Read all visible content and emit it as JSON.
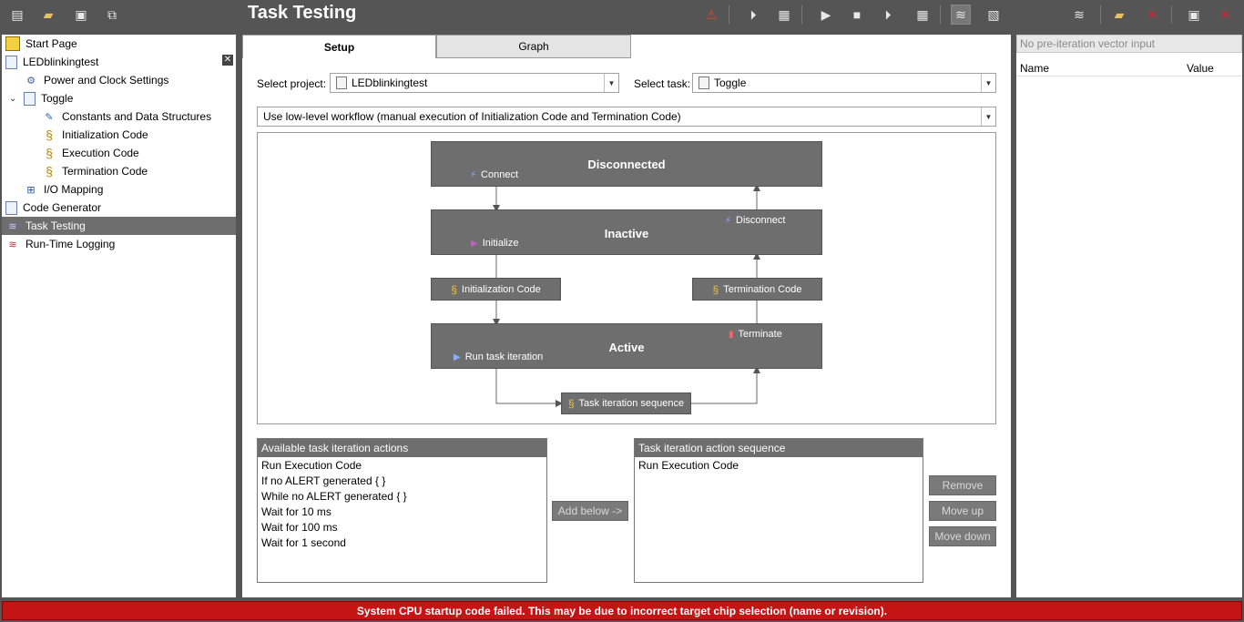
{
  "page": {
    "title": "Task Testing"
  },
  "tree": {
    "items": [
      {
        "label": "Start Page"
      },
      {
        "label": "LEDblinkingtest"
      },
      {
        "label": "Power and Clock Settings"
      },
      {
        "label": "Toggle"
      },
      {
        "label": "Constants and Data Structures"
      },
      {
        "label": "Initialization Code"
      },
      {
        "label": "Execution Code"
      },
      {
        "label": "Termination Code"
      },
      {
        "label": "I/O Mapping"
      },
      {
        "label": "Code Generator"
      },
      {
        "label": "Task Testing"
      },
      {
        "label": "Run-Time Logging"
      }
    ],
    "close_glyph": "✕"
  },
  "tabs": {
    "setup": "Setup",
    "graph": "Graph"
  },
  "form": {
    "select_project_label": "Select project:",
    "project_value": "LEDblinkingtest",
    "select_task_label": "Select task:",
    "task_value": "Toggle",
    "workflow_value": "Use low-level workflow (manual execution of Initialization Code and Termination Code)"
  },
  "diagram": {
    "disconnected": "Disconnected",
    "connect": "Connect",
    "inactive": "Inactive",
    "initialize": "Initialize",
    "disconnect": "Disconnect",
    "init_code": "Initialization Code",
    "term_code": "Termination Code",
    "active": "Active",
    "run_iter": "Run task iteration",
    "terminate": "Terminate",
    "task_seq": "Task iteration sequence"
  },
  "available": {
    "header": "Available task iteration actions",
    "items": [
      "Run Execution Code",
      "If no ALERT generated { }",
      "While no ALERT generated { }",
      "Wait for 10 ms",
      "Wait for 100 ms",
      "Wait for 1 second"
    ]
  },
  "sequence": {
    "header": "Task iteration action sequence",
    "items": [
      "Run Execution Code"
    ]
  },
  "buttons": {
    "add_below": "Add below ->",
    "remove": "Remove",
    "move_up": "Move up",
    "move_down": "Move down"
  },
  "right": {
    "vector_placeholder": "No pre-iteration vector input",
    "col_name": "Name",
    "col_value": "Value"
  },
  "status": {
    "message": "System CPU startup code failed. This may be due to incorrect target chip selection (name or revision)."
  },
  "colors": {
    "status_bg": "#c41414",
    "chrome": "#555555",
    "selected": "#6e6e6e"
  }
}
